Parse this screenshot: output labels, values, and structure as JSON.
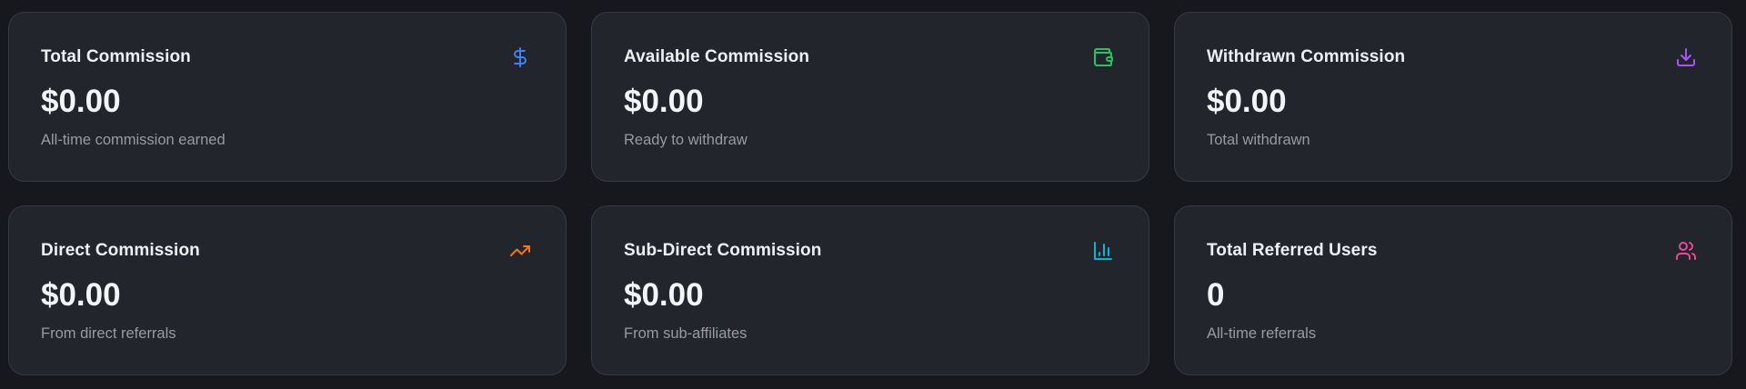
{
  "cards": [
    {
      "title": "Total Commission",
      "value": "$0.00",
      "subtitle": "All-time commission earned",
      "icon": "dollar-icon",
      "color": "#3b82f6"
    },
    {
      "title": "Available Commission",
      "value": "$0.00",
      "subtitle": "Ready to withdraw",
      "icon": "wallet-icon",
      "color": "#22c55e"
    },
    {
      "title": "Withdrawn Commission",
      "value": "$0.00",
      "subtitle": "Total withdrawn",
      "icon": "download-icon",
      "color": "#a855f7"
    },
    {
      "title": "Direct Commission",
      "value": "$0.00",
      "subtitle": "From direct referrals",
      "icon": "trending-up-icon",
      "color": "#f97316"
    },
    {
      "title": "Sub-Direct Commission",
      "value": "$0.00",
      "subtitle": "From sub-affiliates",
      "icon": "bar-chart-icon",
      "color": "#06b6d4"
    },
    {
      "title": "Total Referred Users",
      "value": "0",
      "subtitle": "All-time referrals",
      "icon": "users-icon",
      "color": "#ec4899"
    }
  ]
}
